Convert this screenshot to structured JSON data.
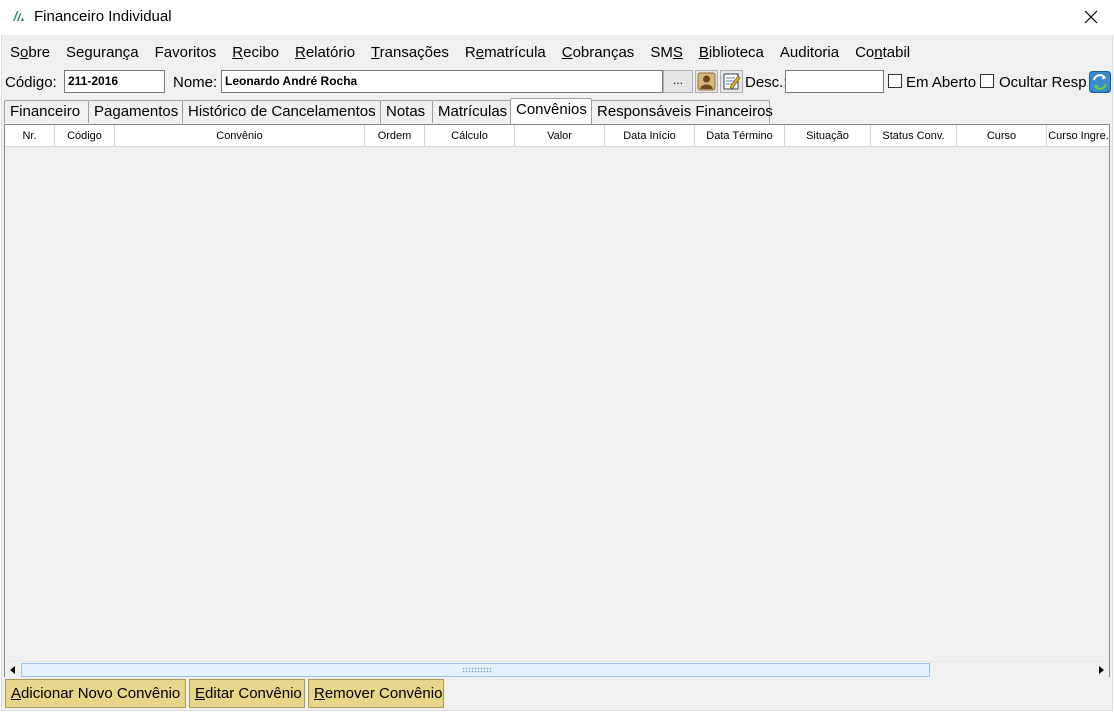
{
  "window": {
    "title": "Financeiro Individual"
  },
  "menu": [
    {
      "pre": "S",
      "u": "o",
      "post": "bre"
    },
    {
      "pre": "Seguran",
      "u": "ç",
      "post": "a"
    },
    {
      "pre": "",
      "u": "",
      "post": "Favoritos"
    },
    {
      "pre": "",
      "u": "R",
      "post": "ecibo"
    },
    {
      "pre": "",
      "u": "R",
      "post": "elatório"
    },
    {
      "pre": "",
      "u": "T",
      "post": "ransações"
    },
    {
      "pre": "R",
      "u": "e",
      "post": "matrícula"
    },
    {
      "pre": "",
      "u": "C",
      "post": "obranças"
    },
    {
      "pre": "SM",
      "u": "S",
      "post": ""
    },
    {
      "pre": "",
      "u": "B",
      "post": "iblioteca"
    },
    {
      "pre": "",
      "u": "",
      "post": "Auditoria"
    },
    {
      "pre": "Co",
      "u": "n",
      "post": "tabil"
    }
  ],
  "toolbar": {
    "codigo_label": "Código:",
    "codigo_value": "211-2016",
    "nome_label": "Nome:",
    "nome_value": "Leonardo André Rocha",
    "dots_label": "...",
    "desc_label": "Desc.:",
    "desc_value": "",
    "em_aberto_label": "Em Aberto",
    "em_aberto_checked": false,
    "ocultar_label": "Ocultar Resp.",
    "ocultar_checked": false
  },
  "tabs": [
    {
      "label": "Financeiro",
      "active": false
    },
    {
      "label": "Pagamentos",
      "active": false
    },
    {
      "label": "Histórico de Cancelamentos",
      "active": false
    },
    {
      "label": "Notas",
      "active": false
    },
    {
      "label": "Matrículas",
      "active": false
    },
    {
      "label": "Convênios",
      "active": true
    },
    {
      "label": "Responsáveis Financeiros",
      "active": false
    }
  ],
  "grid": {
    "columns": [
      "Nr.",
      "Código",
      "Convênio",
      "Ordem",
      "Cálculo",
      "Valor",
      "Data Início",
      "Data Término",
      "Situação",
      "Status Conv.",
      "Curso",
      "Curso Ingre."
    ],
    "rows": []
  },
  "actions": {
    "add": {
      "pre": "",
      "u": "A",
      "post": "dicionar Novo Convênio"
    },
    "edit": {
      "pre": "",
      "u": "E",
      "post": "ditar Convênio"
    },
    "remove": {
      "pre": "",
      "u": "R",
      "post": "emover Convênio"
    }
  },
  "icons": {
    "app": "app-logo-icon",
    "close": "close-icon",
    "person": "person-card-icon",
    "edit": "edit-note-icon",
    "refresh": "refresh-icon",
    "scroll_left": "scroll-left-arrow-icon",
    "scroll_right": "scroll-right-arrow-icon"
  },
  "colors": {
    "action_button": "#e7d58a",
    "active_tab": "#ffffff",
    "window_bg": "#f0f0f0"
  }
}
